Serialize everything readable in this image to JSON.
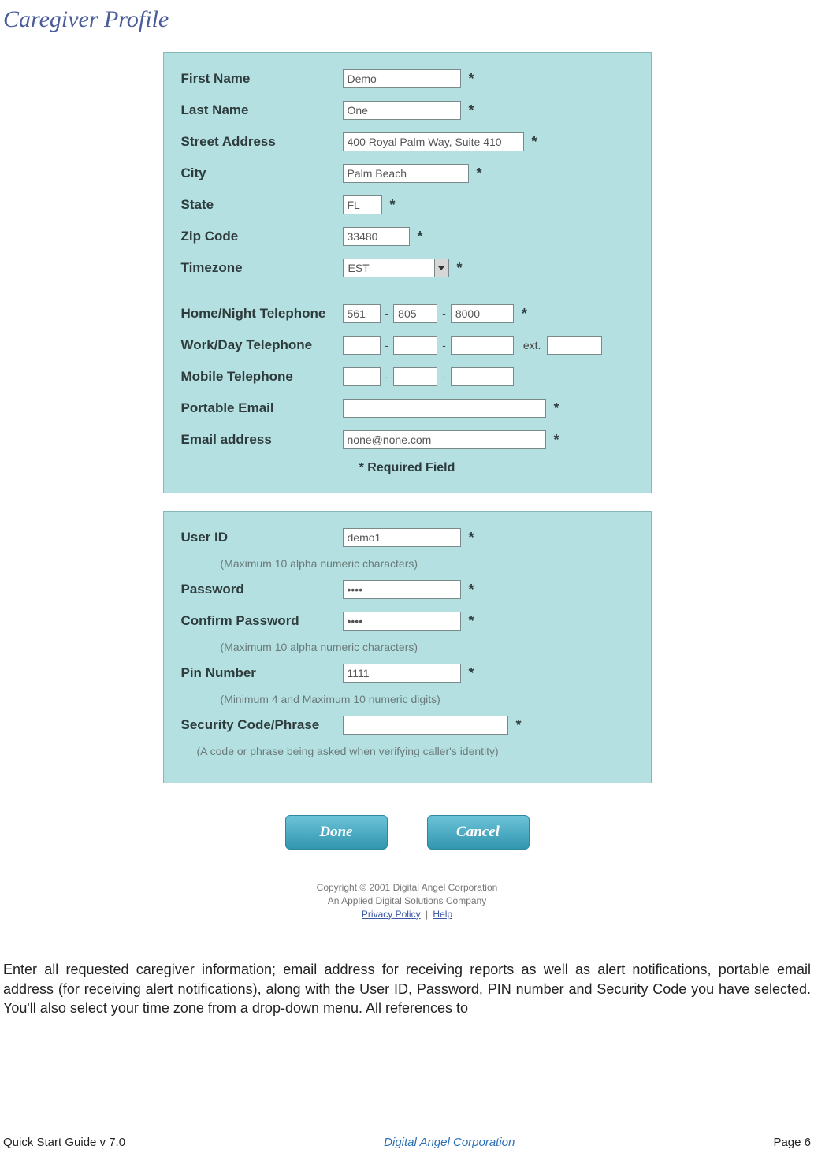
{
  "title": "Caregiver Profile",
  "section1": {
    "labels": {
      "firstName": "First Name",
      "lastName": "Last Name",
      "street": "Street Address",
      "city": "City",
      "state": "State",
      "zip": "Zip Code",
      "timezone": "Timezone",
      "homePhone": "Home/Night Telephone",
      "workPhone": "Work/Day Telephone",
      "mobilePhone": "Mobile Telephone",
      "portableEmail": "Portable Email",
      "email": "Email address"
    },
    "values": {
      "firstName": "Demo",
      "lastName": "One",
      "street": "400 Royal Palm Way, Suite 410",
      "city": "Palm Beach",
      "state": "FL",
      "zip": "33480",
      "timezone": "EST",
      "homePhone": {
        "a": "561",
        "b": "805",
        "c": "8000"
      },
      "workPhone": {
        "a": "",
        "b": "",
        "c": "",
        "ext": ""
      },
      "mobilePhone": {
        "a": "",
        "b": "",
        "c": ""
      },
      "portableEmail": "",
      "email": "none@none.com"
    },
    "extLabel": "ext.",
    "requiredNote": "* Required Field"
  },
  "section2": {
    "labels": {
      "userId": "User ID",
      "password": "Password",
      "confirm": "Confirm Password",
      "pin": "Pin Number",
      "security": "Security Code/Phrase"
    },
    "hints": {
      "userId": "(Maximum 10 alpha numeric characters)",
      "confirm": "(Maximum 10 alpha numeric characters)",
      "pin": "(Minimum 4 and Maximum 10 numeric digits)",
      "security": "(A code or phrase being asked when verifying caller's identity)"
    },
    "values": {
      "userId": "demo1",
      "password": "••••",
      "confirm": "••••",
      "pin": "1111",
      "security": ""
    }
  },
  "buttons": {
    "done": "Done",
    "cancel": "Cancel"
  },
  "copyright": {
    "line1": "Copyright © 2001 Digital Angel Corporation",
    "line2": "An Applied Digital Solutions Company",
    "privacy": "Privacy Policy",
    "help": "Help"
  },
  "bodyText": "Enter all requested caregiver information; email address for receiving reports as well as alert notifications, portable email address (for receiving alert notifications), along with the User ID, Password, PIN number and Security Code you have selected. You'll also select your time zone from a drop-down menu.  All references to",
  "footer": {
    "left": "Quick Start Guide v 7.0",
    "center": "Digital Angel Corporation",
    "right": "Page 6"
  },
  "asterisk": "*",
  "dash": "-"
}
